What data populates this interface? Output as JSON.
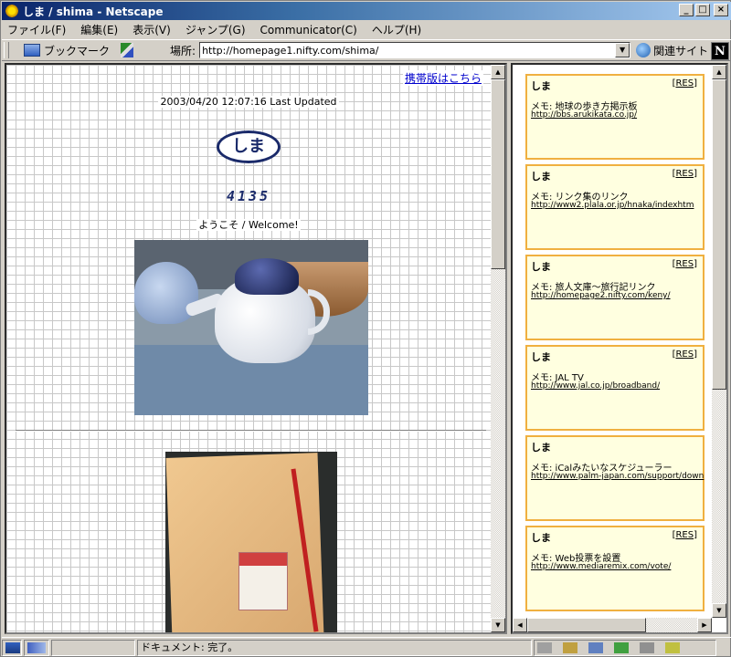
{
  "window": {
    "title": "しま / shima - Netscape",
    "buttons": {
      "minimize": "_",
      "maximize": "□",
      "close": "×"
    }
  },
  "menu": [
    "ファイル(F)",
    "編集(E)",
    "表示(V)",
    "ジャンプ(G)",
    "Communicator(C)",
    "ヘルプ(H)"
  ],
  "toolbar": {
    "bookmarks_label": "ブックマーク",
    "location_label": "場所:",
    "url": "http://homepage1.nifty.com/shima/",
    "related_label": "関連サイト",
    "logo": "N"
  },
  "page": {
    "mobile_link": "携帯版はこちら",
    "updated": "2003/04/20 12:07:16 Last Updated",
    "logo_text": "しま",
    "counter": "4135",
    "welcome": "ようこそ / Welcome!"
  },
  "board": {
    "posts": [
      {
        "name": "しま",
        "res": "RES",
        "memo": "メモ: 地球の歩き方掲示板",
        "url": "http://bbs.arukikata.co.jp/"
      },
      {
        "name": "しま",
        "res": "RES",
        "memo": "メモ: リンク集のリンク",
        "url": "http://www2.plala.or.jp/hnaka/indexhtm"
      },
      {
        "name": "しま",
        "res": "RES",
        "memo": "メモ: 旅人文庫～旅行記リンク",
        "url": "http://homepage2.nifty.com/keny/"
      },
      {
        "name": "しま",
        "res": "RES",
        "memo": "メモ: JAL TV",
        "url": "http://www.jal.co.jp/broadband/"
      },
      {
        "name": "しま",
        "res": "",
        "memo": "メモ: iCalみたいなスケジューラー",
        "url": "http://www.palm-japan.com/support/down"
      },
      {
        "name": "しま",
        "res": "RES",
        "memo": "メモ: Web投票を設置",
        "url": "http://www.mediaremix.com/vote/"
      }
    ]
  },
  "status": {
    "text": "ドキュメント: 完了。"
  }
}
